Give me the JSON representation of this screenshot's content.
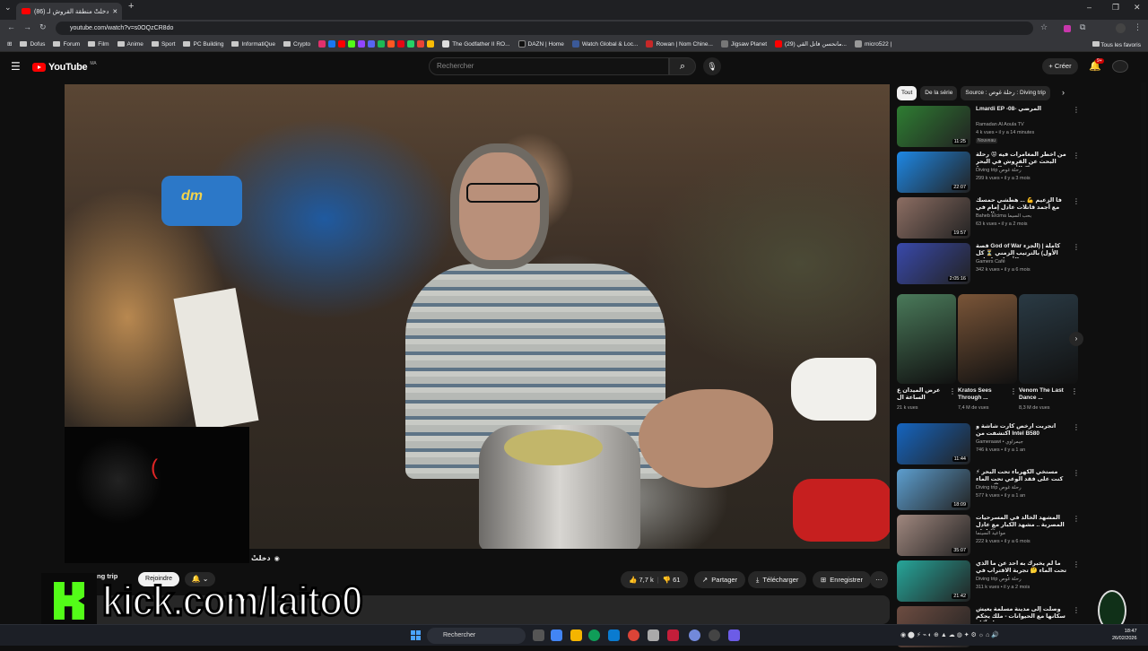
{
  "browser": {
    "tab_title": "(86) دخلتْ منطقة القروش لـ",
    "url": "youtube.com/watch?v=s0OQzCR8do",
    "bookmarks": [
      "Dofus",
      "Forum",
      "Film",
      "Anime",
      "Sport",
      "PC Building",
      "InformatiQue",
      "Crypto",
      "The Godfather II RO...",
      "DAZN | Home",
      "Watch Global & Loc...",
      "Rowan | Nom Chine...",
      "Jigsaw Planet",
      "(29) مانحسن فاتل القي...",
      "micro522 |"
    ],
    "all_favorites": "Tous les favoris"
  },
  "youtube": {
    "logo": "YouTube",
    "region": "MA",
    "search_placeholder": "Rechercher",
    "create_label": "Créer",
    "notif_count": "9+"
  },
  "video": {
    "title": "دخلتْ",
    "channel": "ng trip",
    "join_label": "Rejoindre",
    "likes": "7,7 k",
    "dislikes": "61",
    "share": "Partager",
    "download": "Télécharger",
    "save": "Enregistrer",
    "overlay_text": "kick.com/laito0"
  },
  "sidebar": {
    "chips": [
      "Tout",
      "De la série",
      "Source : رحلة غوص : Diving trip"
    ],
    "recs_top": [
      {
        "title": "Lmardi EP -08- المرضي",
        "channel": "Ramadan Al Aoula TV",
        "meta": "4 k vues • il y a 14 minutes",
        "badge": "Nouveau",
        "dur": "11:25",
        "color": "#2e7d32"
      },
      {
        "title": "من أخطر المغامرات فيه 😡 رحلة البحث عن القروش في البحر الأبيض المتوسط 🦈",
        "channel": "Diving trip رحلة غوص",
        "meta": "299 k vues • il y a 3 mois",
        "badge": "",
        "dur": "22:07",
        "color": "#1e88e5"
      },
      {
        "title": "فأ الزعيم 💪 ... هطشي حمسك مع أجمد قاتلات عادل إمام في مسرحية الزعيم",
        "channel": "Baheb Elcima بحب السيما",
        "meta": "63 k vues • il y a 2 mois",
        "badge": "",
        "dur": "19:57",
        "color": "#8d6e63"
      },
      {
        "title": "قصة God of War كاملة | (الجزء الأول) بالترتيب الزمني ⏳ كل الأجزاء و إضافة ...",
        "channel": "Gamers Café",
        "meta": "342 k vues • il y a 6 mois",
        "badge": "",
        "dur": "2:05:16",
        "color": "#3949ab"
      }
    ],
    "shorts": [
      {
        "title": "عرض الميدان ع الساعة ال",
        "views": "21 k vues",
        "color": "#4a7a5a"
      },
      {
        "title": "Kratos Sees Through ...",
        "views": "7,4 M de vues",
        "color": "#7a5538"
      },
      {
        "title": "Venom The Last Dance ...",
        "views": "8,3 M de vues",
        "color": "#2a3a44"
      }
    ],
    "recs_bottom": [
      {
        "title": "اتجربت ارخص كارت شاشة و اكتشفت من Intel B580",
        "channel": "Gameraawi • جيمراوي",
        "meta": "746 k vues • il y a 1 an",
        "dur": "11:44",
        "color": "#1565c0"
      },
      {
        "title": "مستخي الكهرباء تحت البحر ⚡ كنت على فقد الوعي تحت الماء 😱 تجربة",
        "channel": "Diving trip رحلة غوص",
        "meta": "577 k vues • il y a 1 an",
        "dur": "18:09",
        "color": "#5d9fd0"
      },
      {
        "title": "المشهد الخالد في المسرحيات المصرية .. مشهد الكبار مع عادل امام 😂",
        "channel": "مواعيد السينما",
        "meta": "222 k vues • il y a 6 mois",
        "dur": "35:07",
        "color": "#a1887f"
      },
      {
        "title": "ما لم يخبرك به أحد عن ما الذي تحت الماء 🤔 تجربة الاقتراب في رحلة صيد تحت",
        "channel": "Diving trip رحلة غوص",
        "meta": "311 k vues • il y a 2 mois",
        "dur": "21:42",
        "color": "#26a69a"
      },
      {
        "title": "وصلت إلى مدينة مسلمة يعيش سكانها مع الحيوانات - ملك يحكم قبيلة آكلة",
        "channel": "",
        "meta": "",
        "dur": "",
        "color": "#6d4c41"
      }
    ]
  },
  "taskbar": {
    "search": "Rechercher",
    "time": "18:47",
    "date": "26/02/2026"
  },
  "colors": {
    "yt_red": "#ff0000",
    "kick_green": "#53fc18",
    "bg": "#0f0f0f"
  }
}
